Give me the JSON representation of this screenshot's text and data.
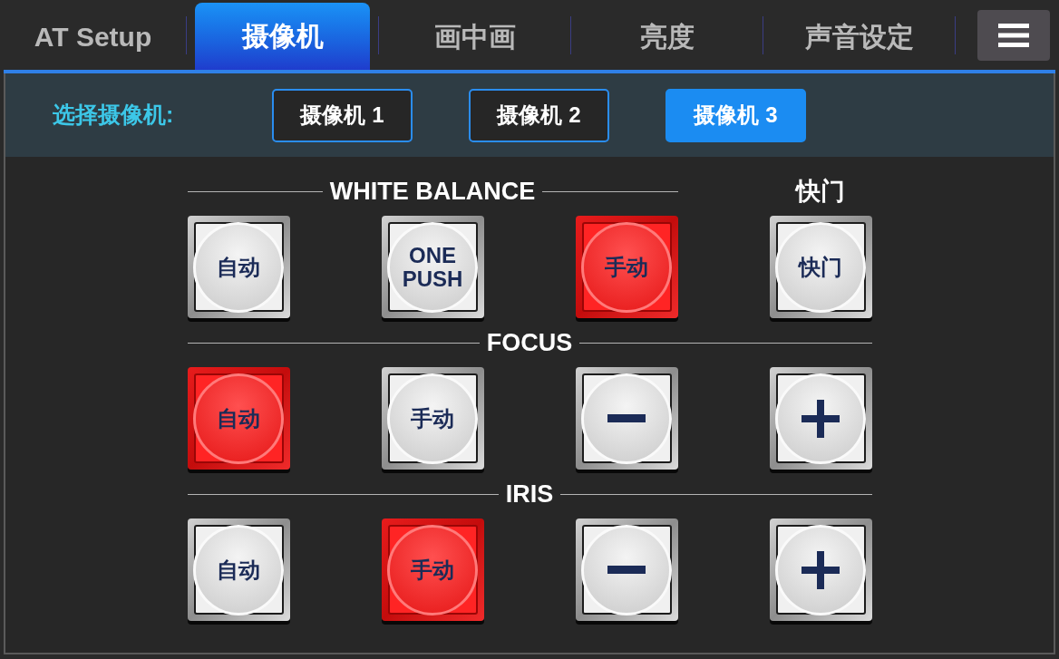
{
  "tabs": [
    {
      "label": "AT Setup",
      "selected": false
    },
    {
      "label": "摄像机",
      "selected": true
    },
    {
      "label": "画中画",
      "selected": false
    },
    {
      "label": "亮度",
      "selected": false
    },
    {
      "label": "声音设定",
      "selected": false
    }
  ],
  "camera_select": {
    "label": "选择摄像机:",
    "cameras": [
      {
        "label": "摄像机 1",
        "selected": false
      },
      {
        "label": "摄像机 2",
        "selected": false
      },
      {
        "label": "摄像机 3",
        "selected": true
      }
    ]
  },
  "rows": [
    {
      "groups": [
        {
          "kind": "ruled",
          "title": "WHITE BALANCE",
          "buttons": [
            {
              "kind": "label",
              "label": "自动",
              "on": false
            },
            {
              "kind": "label",
              "label": "ONE PUSH",
              "on": false
            },
            {
              "kind": "label",
              "label": "手动",
              "on": true
            }
          ]
        },
        {
          "kind": "plain",
          "title": "快门",
          "buttons": [
            {
              "kind": "label",
              "label": "快门",
              "on": false
            }
          ]
        }
      ]
    },
    {
      "groups": [
        {
          "kind": "ruled",
          "title": "FOCUS",
          "buttons": [
            {
              "kind": "label",
              "label": "自动",
              "on": true
            },
            {
              "kind": "label",
              "label": "手动",
              "on": false
            },
            {
              "kind": "minus",
              "on": false
            },
            {
              "kind": "plus",
              "on": false
            }
          ]
        }
      ]
    },
    {
      "groups": [
        {
          "kind": "ruled",
          "title": "IRIS",
          "buttons": [
            {
              "kind": "label",
              "label": "自动",
              "on": false
            },
            {
              "kind": "label",
              "label": "手动",
              "on": true
            },
            {
              "kind": "minus",
              "on": false
            },
            {
              "kind": "plus",
              "on": false
            }
          ]
        }
      ]
    }
  ]
}
